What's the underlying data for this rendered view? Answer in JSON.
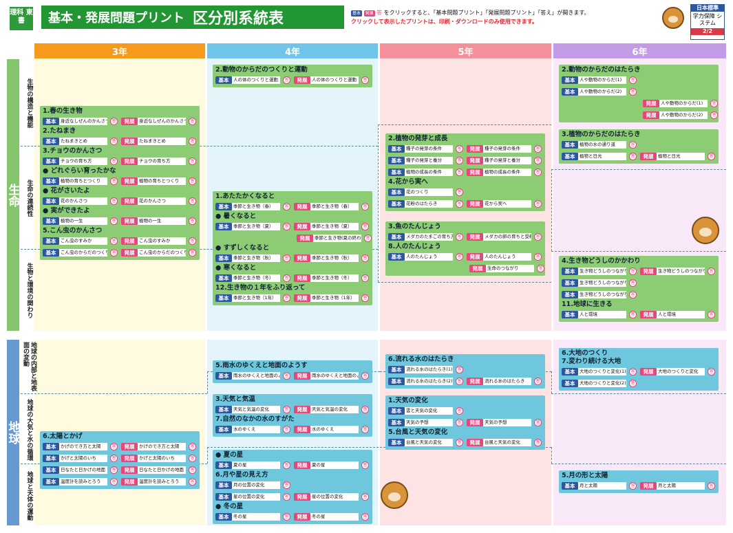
{
  "header": {
    "logo": "理科 東書",
    "title": "基本・発展問題プリント",
    "subtitle": "区分別系統表",
    "notice1_prefix": "基本",
    "notice1_mid": "発展",
    "notice1_ans": "答",
    "notice1_text": "をクリックすると、「基本問題プリント」「発展問題プリント」「答え」が開きます。",
    "notice2": "クリックして表示したプリントは、印刷・ダウンロードのみ使用できます。",
    "brand1": "日本標準",
    "brand2": "学力保障 システム",
    "brand3": "2/2"
  },
  "colors": {
    "g3": "#f59a1b",
    "g4": "#70c4ea",
    "g5": "#f3909a",
    "g6": "#c49be6",
    "life": "#85c56c",
    "earth": "#6699d0",
    "kihon": "#2d56a0",
    "hatten": "#e8457a"
  },
  "grades": [
    "3年",
    "4年",
    "5年",
    "6年"
  ],
  "categories": {
    "life": "生命",
    "earth": "地球"
  },
  "subcats": {
    "s1": "生物の構造と機能",
    "s2": "生命の連続性",
    "s3": "生物と環境の関わり",
    "s4": "地球の内部と地表面の変動",
    "s5": "地球の大気と水の循環",
    "s6": "地球と天体の運動"
  },
  "labels": {
    "kihon": "基本",
    "hatten": "発展",
    "ans": "答"
  },
  "boxes": {
    "g3a": {
      "lines": [
        {
          "sec": "1.春の生き物"
        },
        {
          "k": "身近なしぜんのかんさつ",
          "h": "身近なしぜんのかんさつ"
        },
        {
          "sec": "2.たねまき"
        },
        {
          "k": "たねまきとめ",
          "h": "たねまきとめ"
        },
        {
          "sec": "3.チョウのかんさつ"
        },
        {
          "k": "チョウの育ち方",
          "h": "チョウの育ち方"
        },
        {
          "sec": "● どれぐらい育ったかな"
        },
        {
          "k": "植物の育ちとつくり",
          "h": "植物の育ちとつくり"
        },
        {
          "sec": "● 花がさいたよ"
        },
        {
          "k": "花のかんさつ",
          "h": "花のかんさつ"
        },
        {
          "sec": "● 実ができたよ"
        },
        {
          "k": "植物の一生",
          "h": "植物の一生"
        },
        {
          "sec": "5.こん虫のかんさつ"
        },
        {
          "k": "こん虫のすみか",
          "h": "こん虫のすみか"
        },
        {
          "k": "こん虫のからだのつくり",
          "h": "こん虫のからだのつくり"
        }
      ]
    },
    "g4a": {
      "lines": [
        {
          "sec": "2.動物のからだのつくりと運動"
        },
        {
          "k": "人の体のつくりと運動",
          "h": "人の体のつくりと運動"
        }
      ]
    },
    "g4b": {
      "lines": [
        {
          "sec": "1.あたたかくなると"
        },
        {
          "k": "季節と生き物（春）",
          "h": "季節と生き物（春）"
        },
        {
          "sec": "● 暑くなると"
        },
        {
          "k": "季節と生き物（夏）",
          "h": "季節と生き物（夏）"
        },
        {
          "h": "季節と生き物(夏の終わり)"
        },
        {
          "sec": "● すずしくなると"
        },
        {
          "k": "季節と生き物（秋）",
          "h": "季節と生き物（秋）"
        },
        {
          "sec": "● 寒くなると"
        },
        {
          "k": "季節と生き物（冬）",
          "h": "季節と生き物（冬）"
        },
        {
          "sec": "12.生き物の１年をふり返って"
        },
        {
          "k": "季節と生き物（1年）",
          "h": "季節と生き物（1年）"
        }
      ]
    },
    "g5a": {
      "lines": [
        {
          "sec": "2.植物の発芽と成長"
        },
        {
          "k": "種子の発芽の条件",
          "h": "種子の発芽の条件"
        },
        {
          "k": "種子の発芽と養分",
          "h": "種子の発芽と養分"
        },
        {
          "k": "植物の成長の条件",
          "h": "植物の成長の条件"
        },
        {
          "sec": "4.花から実へ"
        },
        {
          "k": "花のつくり"
        },
        {
          "k": "花粉のはたらき",
          "h": "花から実へ"
        }
      ]
    },
    "g5b": {
      "lines": [
        {
          "sec": "3.魚のたんじょう"
        },
        {
          "k": "メダカのたまごの育ち方",
          "h": "メダカの卵の育ちと受精卵"
        },
        {
          "sec": "8.人のたんじょう"
        },
        {
          "k": "人のたんじょう",
          "h": "人のたんじょう"
        },
        {
          "h": "生命のつながり"
        }
      ]
    },
    "g6a": {
      "lines": [
        {
          "sec": "2.動物のからだのはたらき"
        },
        {
          "k": "人や動物のからだ(1)"
        },
        {
          "k": "人や動物のからだ(2)"
        },
        {
          "h": "人や動物のからだ(1)",
          "hr": true
        },
        {
          "h": "人や動物のからだ(2)",
          "hr": true
        }
      ]
    },
    "g6b": {
      "lines": [
        {
          "sec": "3.植物のからだのはたらき"
        },
        {
          "k": "植物の水の通り道"
        },
        {
          "k": "植物と日光",
          "h": "植物と日光"
        }
      ]
    },
    "g6c": {
      "lines": [
        {
          "sec": "4.生き物どうしのかかわり"
        },
        {
          "k": "生き物どうしのつながり(1)",
          "h": "生き物どうしのつながり"
        },
        {
          "k": "生き物どうしのつながり(2)"
        },
        {
          "k": "生き物どうしのつながり(3)"
        },
        {
          "sec": "11.地球に生きる"
        },
        {
          "k": "人と環境",
          "h": "人と環境"
        }
      ]
    },
    "g3b": {
      "lines": [
        {
          "sec": "6.太陽とかげ"
        },
        {
          "k": "かげのでき方と太陽",
          "h": "かげのでき方と太陽"
        },
        {
          "k": "かげと太陽のいち",
          "h": "かげと太陽のいち"
        },
        {
          "k": "日なたと日かげの地面",
          "h": "日なたと日かげの地面"
        },
        {
          "k": "温度計を読みとろう",
          "h": "温度計を読みとろう"
        }
      ]
    },
    "g4c": {
      "lines": [
        {
          "sec": "5.雨水のゆくえと地面のようす"
        },
        {
          "k": "雨水のゆくえと地面のようす",
          "h": "雨水のゆくえと地面のようす"
        }
      ]
    },
    "g4d": {
      "lines": [
        {
          "sec": "3.天気と気温"
        },
        {
          "k": "天気と気温の変化",
          "h": "天気と気温の変化"
        },
        {
          "sec": "7.自然のなかの水のすがた"
        },
        {
          "k": "水のゆくえ",
          "h": "水のゆくえ"
        }
      ]
    },
    "g4e": {
      "lines": [
        {
          "sec": "● 夏の星"
        },
        {
          "k": "夏の星",
          "h": "夏の星"
        },
        {
          "sec": "6.月や星の見え方"
        },
        {
          "k": "月の位置の変化"
        },
        {
          "k": "星の位置の変化",
          "h": "星の位置の変化"
        },
        {
          "sec": "● 冬の星"
        },
        {
          "k": "冬の星",
          "h": "冬の星"
        }
      ]
    },
    "g5c": {
      "lines": [
        {
          "sec": "6.流れる水のはたらき"
        },
        {
          "k": "流れる水のはたらき(1)"
        },
        {
          "k": "流れる水のはたらき(2)",
          "h": "流れる水のはたらき"
        }
      ]
    },
    "g5d": {
      "lines": [
        {
          "sec": "1.天気の変化"
        },
        {
          "k": "雲と天気の変化"
        },
        {
          "k": "天気の予想",
          "h": "天気の予想"
        },
        {
          "sec": "5.台風と天気の変化"
        },
        {
          "k": "台風と天気の変化",
          "h": "台風と天気の変化"
        }
      ]
    },
    "g6d": {
      "lines": [
        {
          "sec": "6.大地のつくり"
        },
        {
          "sec": "7.変わり続ける大地"
        },
        {
          "k": "大地のつくりと変化(1)",
          "h": "大地のつくりと変化"
        },
        {
          "k": "大地のつくりと変化(2)"
        }
      ]
    },
    "g6e": {
      "lines": [
        {
          "sec": "5.月の形と太陽"
        },
        {
          "k": "月と太陽",
          "h": "月と太陽"
        }
      ]
    }
  }
}
